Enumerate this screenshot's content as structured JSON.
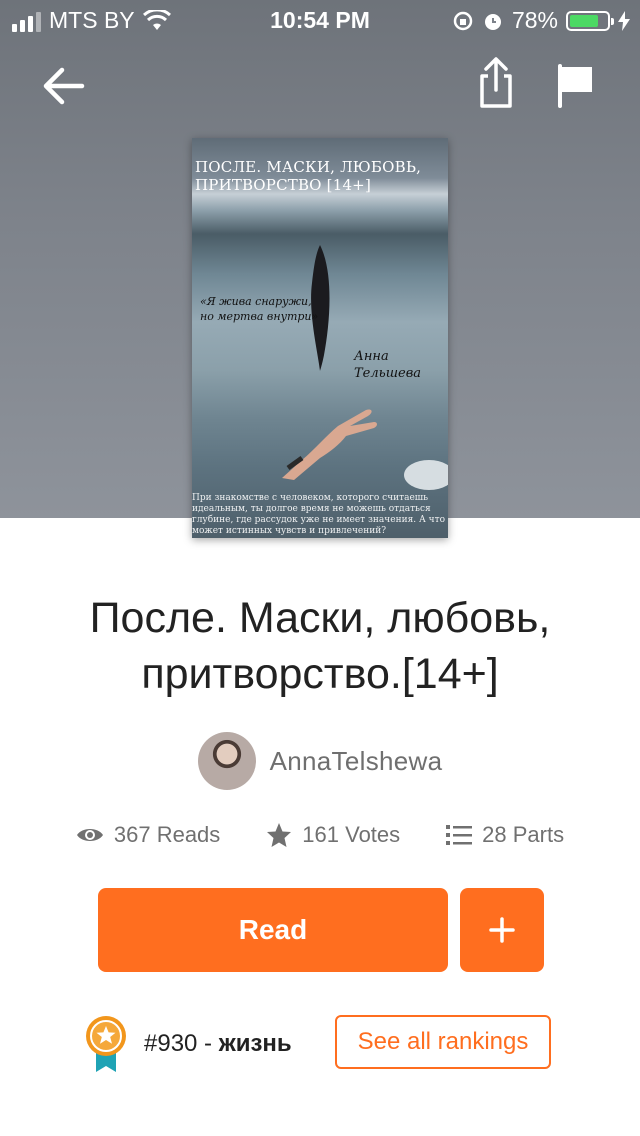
{
  "status_bar": {
    "carrier": "MTS BY",
    "time": "10:54 PM",
    "battery_percent": "78%",
    "battery_level": 0.78,
    "icons": [
      "signal-icon",
      "wifi-icon",
      "orientation-lock-icon",
      "alarm-icon",
      "battery-icon",
      "charging-bolt-icon"
    ]
  },
  "header": {
    "icons": [
      "back-arrow-icon",
      "share-icon",
      "flag-icon"
    ]
  },
  "cover": {
    "title": "ПОСЛЕ. МАСКИ, ЛЮБОВЬ, ПРИТВОРСТВО [14+]",
    "quote": "«Я жива снаружи, но мертва внутри»",
    "author": "Анна Тельшева",
    "blurb": "При знакомстве с человеком, которого считаешь идеальным, ты долгое время не можешь отдаться глубине, где рассудок уже не имеет значения. А что может истинных чувств и привлечений?"
  },
  "story": {
    "title": "После. Маски, любовь, притворство.[14+]",
    "author": "AnnaTelshewa"
  },
  "stats": {
    "reads": "367 Reads",
    "votes": "161 Votes",
    "parts": "28 Parts"
  },
  "actions": {
    "read_label": "Read",
    "add_label": "+"
  },
  "ranking": {
    "rank": "#930",
    "separator": " - ",
    "tag": "жизнь",
    "see_all_label": "See all rankings"
  },
  "colors": {
    "accent": "#ff6e1f",
    "header_bg": "#7d828a",
    "text_dark": "#222222",
    "text_muted": "#707070",
    "medal_orange": "#f2961c",
    "medal_ribbon": "#1fa3b5"
  }
}
